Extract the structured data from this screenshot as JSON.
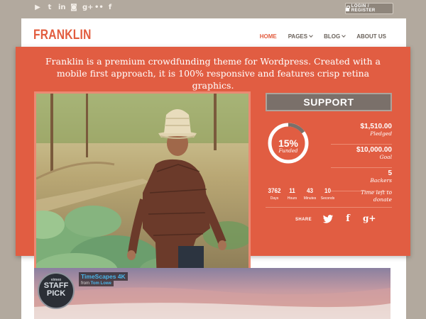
{
  "topbar": {
    "socials": [
      {
        "icon": "youtube-icon",
        "glyph": "▶"
      },
      {
        "icon": "twitter-icon",
        "glyph": "t"
      },
      {
        "icon": "linkedin-icon",
        "glyph": "in"
      },
      {
        "icon": "instagram-icon",
        "glyph": "◙"
      },
      {
        "icon": "google-plus-icon",
        "glyph": "g+"
      },
      {
        "icon": "flickr-icon",
        "glyph": "••"
      },
      {
        "icon": "facebook-icon",
        "glyph": "f"
      }
    ],
    "login_label": "LOGIN / REGISTER"
  },
  "header": {
    "logo": "FRANKLIN",
    "nav": {
      "home": "HOME",
      "pages": "PAGES",
      "blog": "BLOG",
      "about": "ABOUT US"
    }
  },
  "hero": {
    "tagline": "Franklin is a premium crowdfunding theme for Wordpress. Created with a mobile first approach, it is 100% responsive and features crisp retina graphics."
  },
  "campaign": {
    "support_label": "SUPPORT",
    "percent": "15%",
    "percent_value": 0.15,
    "percent_label": "Funded",
    "pledged": "$1,510.00",
    "pledged_label": "Pledged",
    "goal": "$10,000.00",
    "goal_label": "Goal",
    "backers": "5",
    "backers_label": "Backers",
    "timer": {
      "days": "3762",
      "days_label": "Days",
      "hours": "11",
      "hours_label": "Hours",
      "minutes": "43",
      "minutes_label": "Minutes",
      "seconds": "10",
      "seconds_label": "Seconds"
    },
    "time_left_label": "Time left to donate",
    "share_label": "SHARE"
  },
  "video": {
    "badge_brand": "vimeo",
    "badge_line1": "STAFF",
    "badge_line2": "PICK",
    "title": "TimeScapes 4K",
    "from_label": "from",
    "author": "Tom Lowe"
  },
  "colors": {
    "accent": "#e15d42",
    "background": "#b2a99e",
    "support_button": "#7a706a"
  }
}
